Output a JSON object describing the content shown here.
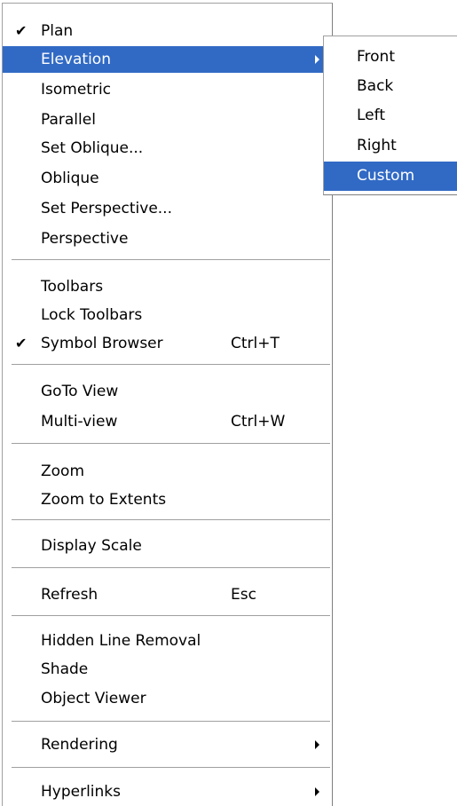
{
  "menu": {
    "items": [
      {
        "label": "Plan",
        "checked": true
      },
      {
        "label": "Elevation",
        "has_submenu": true,
        "highlighted": true
      },
      {
        "label": "Isometric"
      },
      {
        "label": "Parallel"
      },
      {
        "label": "Set Oblique..."
      },
      {
        "label": "Oblique"
      },
      {
        "label": "Set Perspective..."
      },
      {
        "label": "Perspective"
      },
      {
        "label": "Toolbars"
      },
      {
        "label": "Lock Toolbars"
      },
      {
        "label": "Symbol Browser",
        "checked": true,
        "shortcut": "Ctrl+T"
      },
      {
        "label": "GoTo View"
      },
      {
        "label": "Multi-view",
        "shortcut": "Ctrl+W"
      },
      {
        "label": "Zoom"
      },
      {
        "label": "Zoom to Extents"
      },
      {
        "label": "Display Scale"
      },
      {
        "label": "Refresh",
        "shortcut": "Esc"
      },
      {
        "label": "Hidden Line Removal"
      },
      {
        "label": "Shade"
      },
      {
        "label": "Object Viewer"
      },
      {
        "label": "Rendering",
        "has_submenu": true
      },
      {
        "label": "Hyperlinks",
        "has_submenu": true
      }
    ],
    "check_glyph": "✔"
  },
  "submenu": {
    "items": [
      {
        "label": "Front"
      },
      {
        "label": "Back"
      },
      {
        "label": "Left"
      },
      {
        "label": "Right"
      },
      {
        "label": "Custom",
        "highlighted": true
      }
    ]
  },
  "colors": {
    "highlight": "#316ac5",
    "separator": "#a0a0a0"
  }
}
